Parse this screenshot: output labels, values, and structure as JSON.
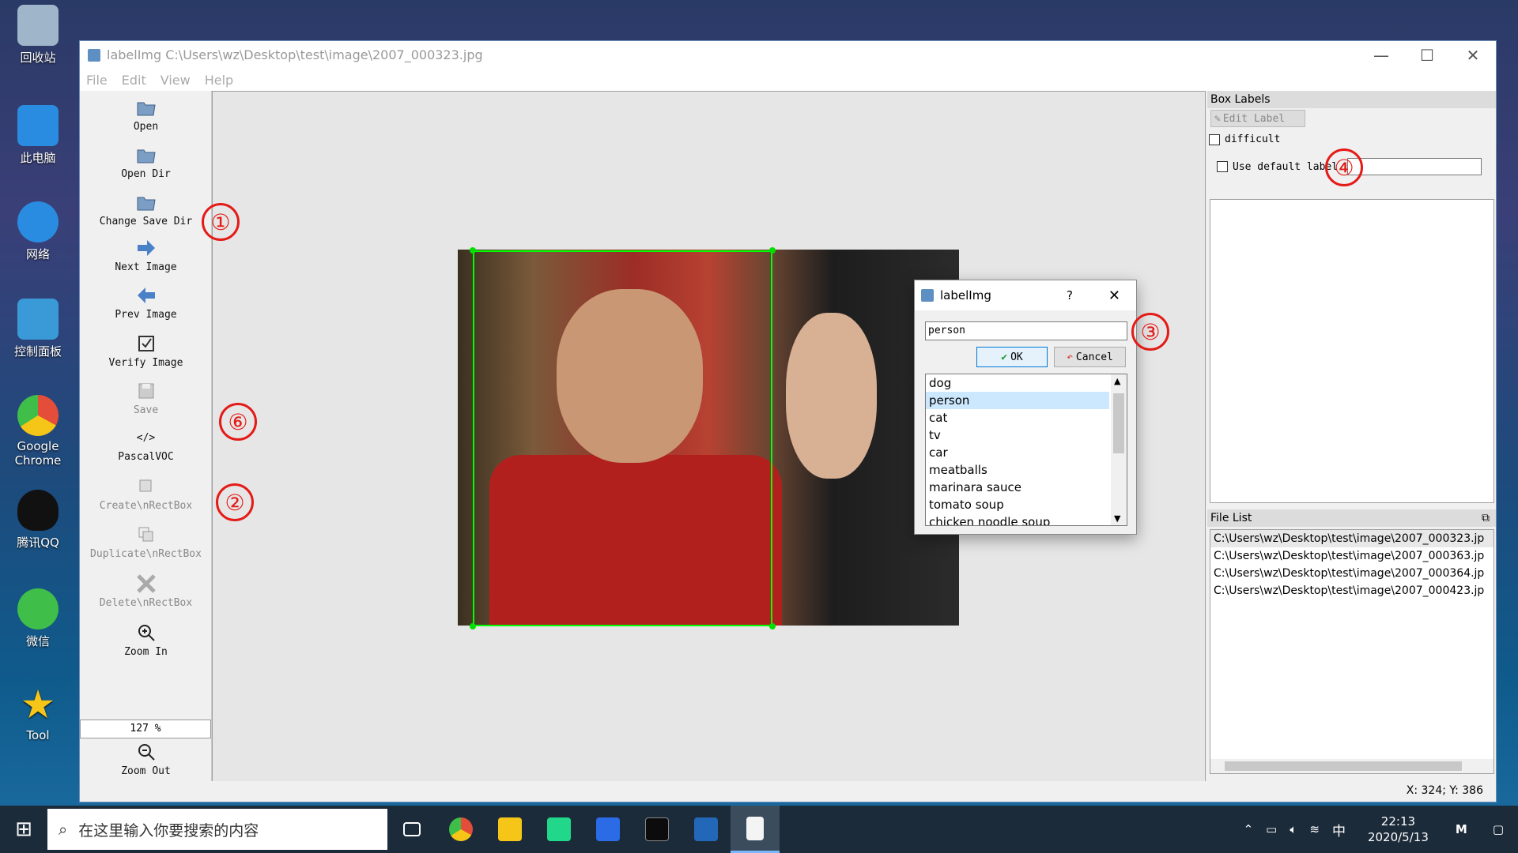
{
  "desktop": {
    "icons": [
      {
        "label": "回收站",
        "color": "#9fb5c9"
      },
      {
        "label": "此电脑",
        "color": "#2a8ce0"
      },
      {
        "label": "网络",
        "color": "#2a8ce0"
      },
      {
        "label": "控制面板",
        "color": "#3a9ad8"
      },
      {
        "label": "Google\nChrome",
        "color": "#e44d3a"
      },
      {
        "label": "腾讯QQ",
        "color": "#111111"
      },
      {
        "label": "微信",
        "color": "#3fbf4a"
      },
      {
        "label": "Tool",
        "color": "#f5c518"
      }
    ]
  },
  "window": {
    "title": "labelImg C:\\Users\\wz\\Desktop\\test\\image\\2007_000323.jpg",
    "minimize": "—",
    "maximize": "☐",
    "close": "✕"
  },
  "menu": [
    "File",
    "Edit",
    "View",
    "Help"
  ],
  "toolbar": {
    "open": "Open",
    "open_dir": "Open Dir",
    "change_save_dir": "Change Save Dir",
    "next_image": "Next Image",
    "prev_image": "Prev Image",
    "verify_image": "Verify Image",
    "save": "Save",
    "format": "PascalVOC",
    "format_icon": "</>",
    "create_rect": "Create\\nRectBox",
    "duplicate_rect": "Duplicate\\nRectBox",
    "delete_rect": "Delete\\nRectBox",
    "zoom_in": "Zoom In",
    "zoom_value": "127 %",
    "zoom_out": "Zoom Out",
    "more": "⌄"
  },
  "box_labels": {
    "title": "Box Labels",
    "edit_label": "Edit Label",
    "difficult": "difficult",
    "use_default_label": "Use default label",
    "default_label_value": ""
  },
  "file_list": {
    "title": "File List",
    "files": [
      "C:\\Users\\wz\\Desktop\\test\\image\\2007_000323.jp",
      "C:\\Users\\wz\\Desktop\\test\\image\\2007_000363.jp",
      "C:\\Users\\wz\\Desktop\\test\\image\\2007_000364.jp",
      "C:\\Users\\wz\\Desktop\\test\\image\\2007_000423.jp"
    ]
  },
  "status": {
    "coords": "X: 324; Y: 386"
  },
  "dialog": {
    "title": "labelImg",
    "help": "?",
    "close": "✕",
    "input_value": "person",
    "ok": "OK",
    "cancel": "Cancel",
    "labels": [
      "dog",
      "person",
      "cat",
      "tv",
      "car",
      "meatballs",
      "marinara sauce",
      "tomato soup",
      "chicken noodle soup"
    ],
    "selected": "person"
  },
  "annotations": [
    "①",
    "②",
    "③",
    "④",
    "⑥"
  ],
  "taskbar": {
    "search_placeholder": "在这里输入你要搜索的内容",
    "ime": "中",
    "time": "22:13",
    "date": "2020/5/13"
  }
}
